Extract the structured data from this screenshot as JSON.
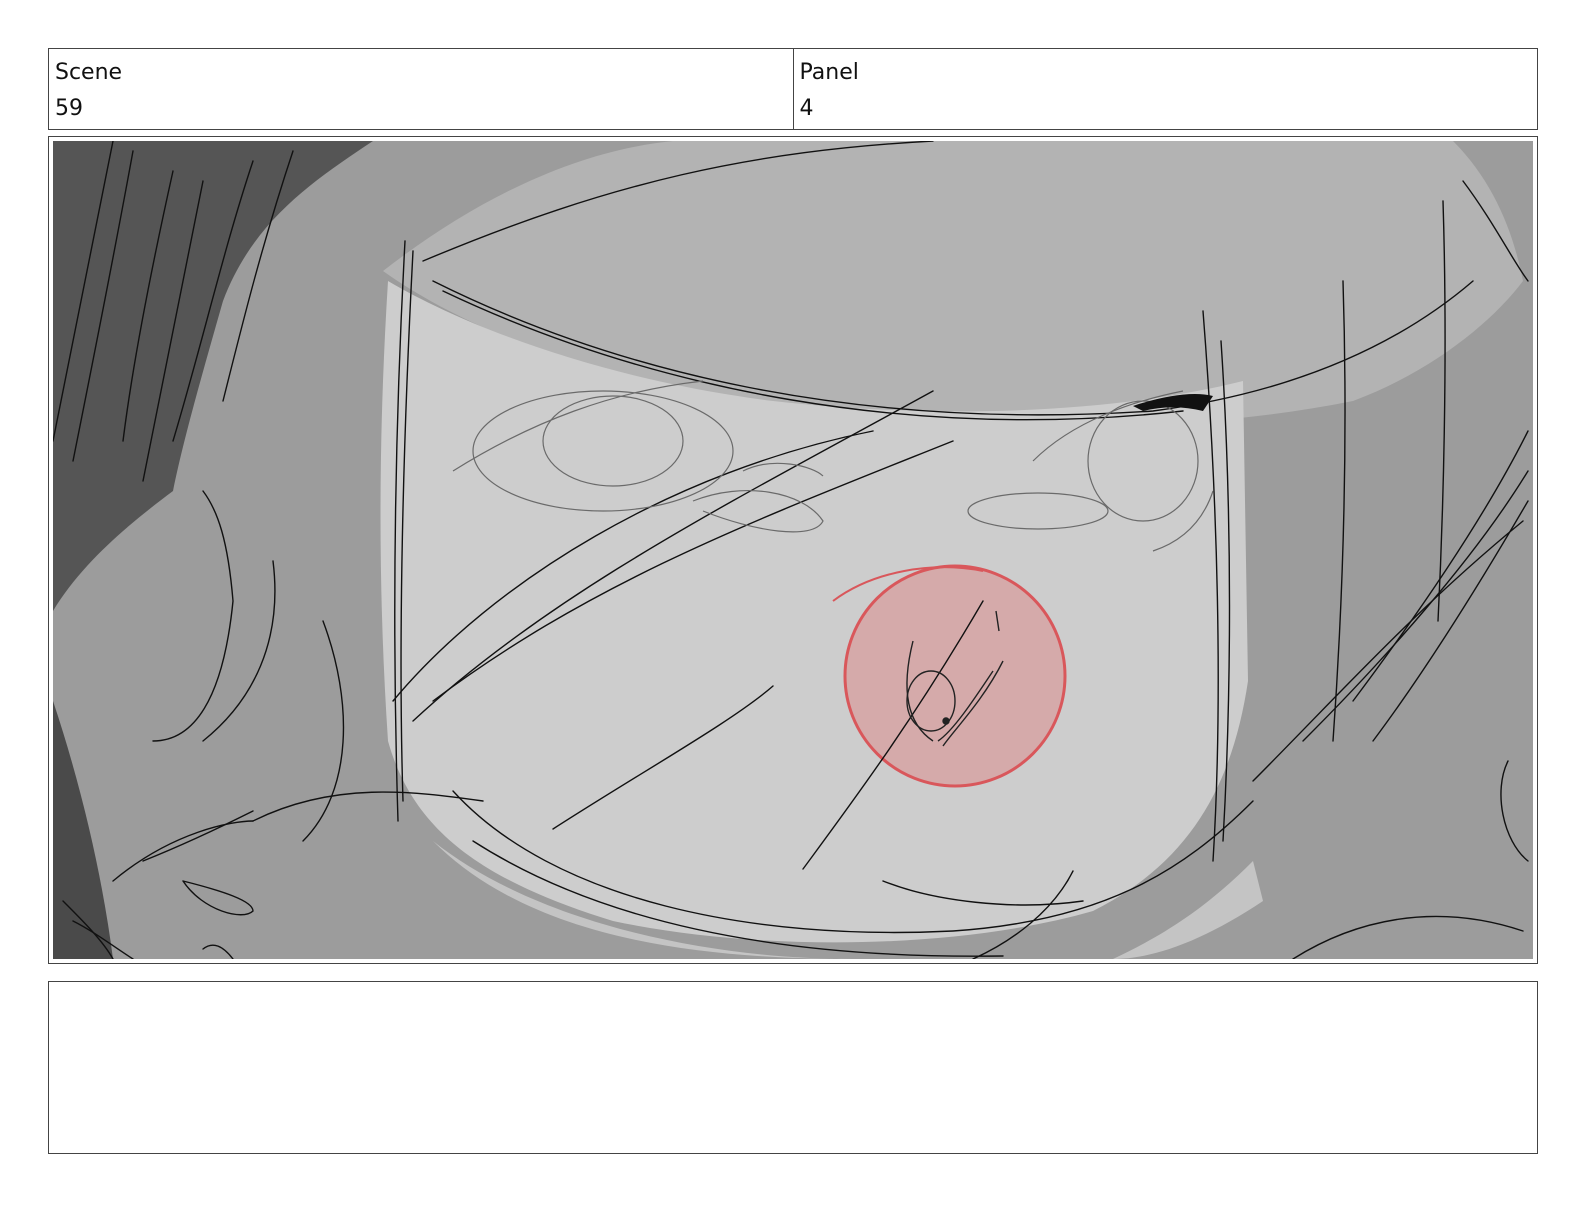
{
  "header": {
    "scene": {
      "label": "Scene",
      "value": "59"
    },
    "panel": {
      "label": "Panel",
      "value": "4"
    }
  },
  "colors": {
    "background_dark": "#5a5a5a",
    "background_mid": "#9c9c9c",
    "helmet_light": "#cdcdcd",
    "helmet_top": "#b3b3b3",
    "highlight_red": "#e08080",
    "line": "#111111"
  },
  "notes": {
    "text": ""
  }
}
